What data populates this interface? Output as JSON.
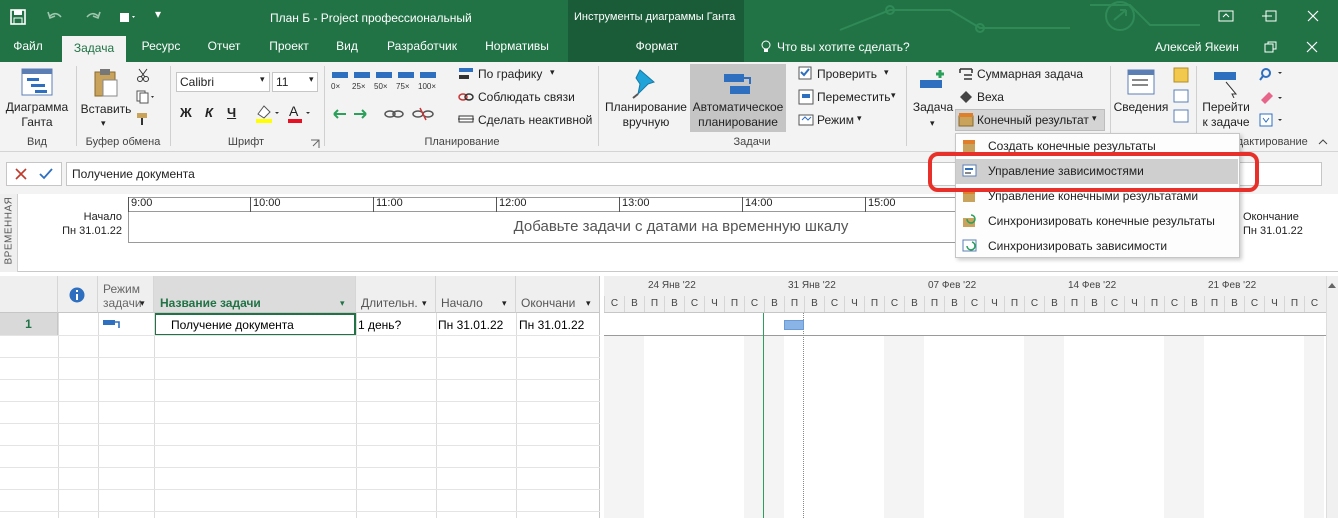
{
  "qat": {
    "save_icon": "save-icon",
    "undo_icon": "undo-icon",
    "redo_icon": "redo-icon"
  },
  "window": {
    "title": "План Б - Project профессиональный",
    "contextual_tab_group": "Инструменты диаграммы Ганта",
    "user": "Алексей Якеин"
  },
  "tabs": [
    "Файл",
    "Задача",
    "Ресурс",
    "Отчет",
    "Проект",
    "Вид",
    "Разработчик",
    "Нормативы",
    "Формат"
  ],
  "tell_me": "Что вы хотите сделать?",
  "ribbon": {
    "view": {
      "gantt_label": "Диаграмма\nГанта",
      "group": "Вид"
    },
    "clipboard": {
      "paste_label": "Вставить",
      "group": "Буфер обмена"
    },
    "font": {
      "font_name": "Calibri",
      "font_size": "11",
      "bold": "Ж",
      "italic": "К",
      "underline": "Ч",
      "group": "Шрифт"
    },
    "schedule": {
      "pct": [
        "0×",
        "25×",
        "50×",
        "75×",
        "100×"
      ],
      "on_track": "По графику",
      "respect_links": "Соблюдать связи",
      "inactive": "Сделать неактивной",
      "group": "Планирование"
    },
    "tasks": {
      "manual": "Планирование\nвручную",
      "auto": "Автоматическое\nпланирование",
      "inspect": "Проверить",
      "move": "Переместить",
      "mode": "Режим",
      "group": "Задачи"
    },
    "insert": {
      "task": "Задача",
      "summary": "Суммарная задача",
      "milestone": "Веха",
      "deliverable": "Конечный результат"
    },
    "properties": {
      "info": "Сведения"
    },
    "editing": {
      "goto": "Перейти\nк задаче",
      "group": "Редактирование"
    }
  },
  "formula_bar": {
    "value": "Получение документа"
  },
  "timeline": {
    "side_label": "ВРЕМЕННАЯ",
    "start_label": "Начало",
    "start_date": "Пн 31.01.22",
    "end_label": "Окончание",
    "end_date": "Пн 31.01.22",
    "ticks": [
      "9:00",
      "10:00",
      "11:00",
      "12:00",
      "13:00",
      "14:00",
      "15:00"
    ],
    "placeholder": "Добавьте задачи с датами на временную шкалу"
  },
  "grid": {
    "columns": [
      "Режим\nзадачи",
      "Название задачи",
      "Длительн.",
      "Начало",
      "Окончани"
    ],
    "rows": [
      {
        "id": "1",
        "name": "Получение документа",
        "duration": "1 день?",
        "start": "Пн 31.01.22",
        "finish": "Пн 31.01.22"
      }
    ]
  },
  "gantt": {
    "weeks": [
      "24 Янв '22",
      "31 Янв '22",
      "07 Фев '22",
      "14 Фев '22",
      "21 Фев '22"
    ],
    "days": [
      "С",
      "В",
      "П",
      "В",
      "С",
      "Ч",
      "П",
      "С",
      "В",
      "П",
      "В",
      "С",
      "Ч",
      "П",
      "С",
      "В",
      "П",
      "В",
      "С",
      "Ч",
      "П",
      "С",
      "В",
      "П",
      "В",
      "С",
      "Ч",
      "П",
      "С",
      "В",
      "П",
      "В",
      "С",
      "Ч",
      "П",
      "С"
    ]
  },
  "dropdown": {
    "items": [
      {
        "label": "Создать конечные результаты",
        "state": "normal"
      },
      {
        "label": "Управление зависимостями",
        "state": "highlighted"
      },
      {
        "label": "Управление конечными результатами",
        "state": "normal"
      },
      {
        "label": "Синхронизировать конечные результаты",
        "state": "normal"
      },
      {
        "label": "Синхронизировать зависимости",
        "state": "normal"
      }
    ],
    "highlight_color": "#e8302a"
  }
}
